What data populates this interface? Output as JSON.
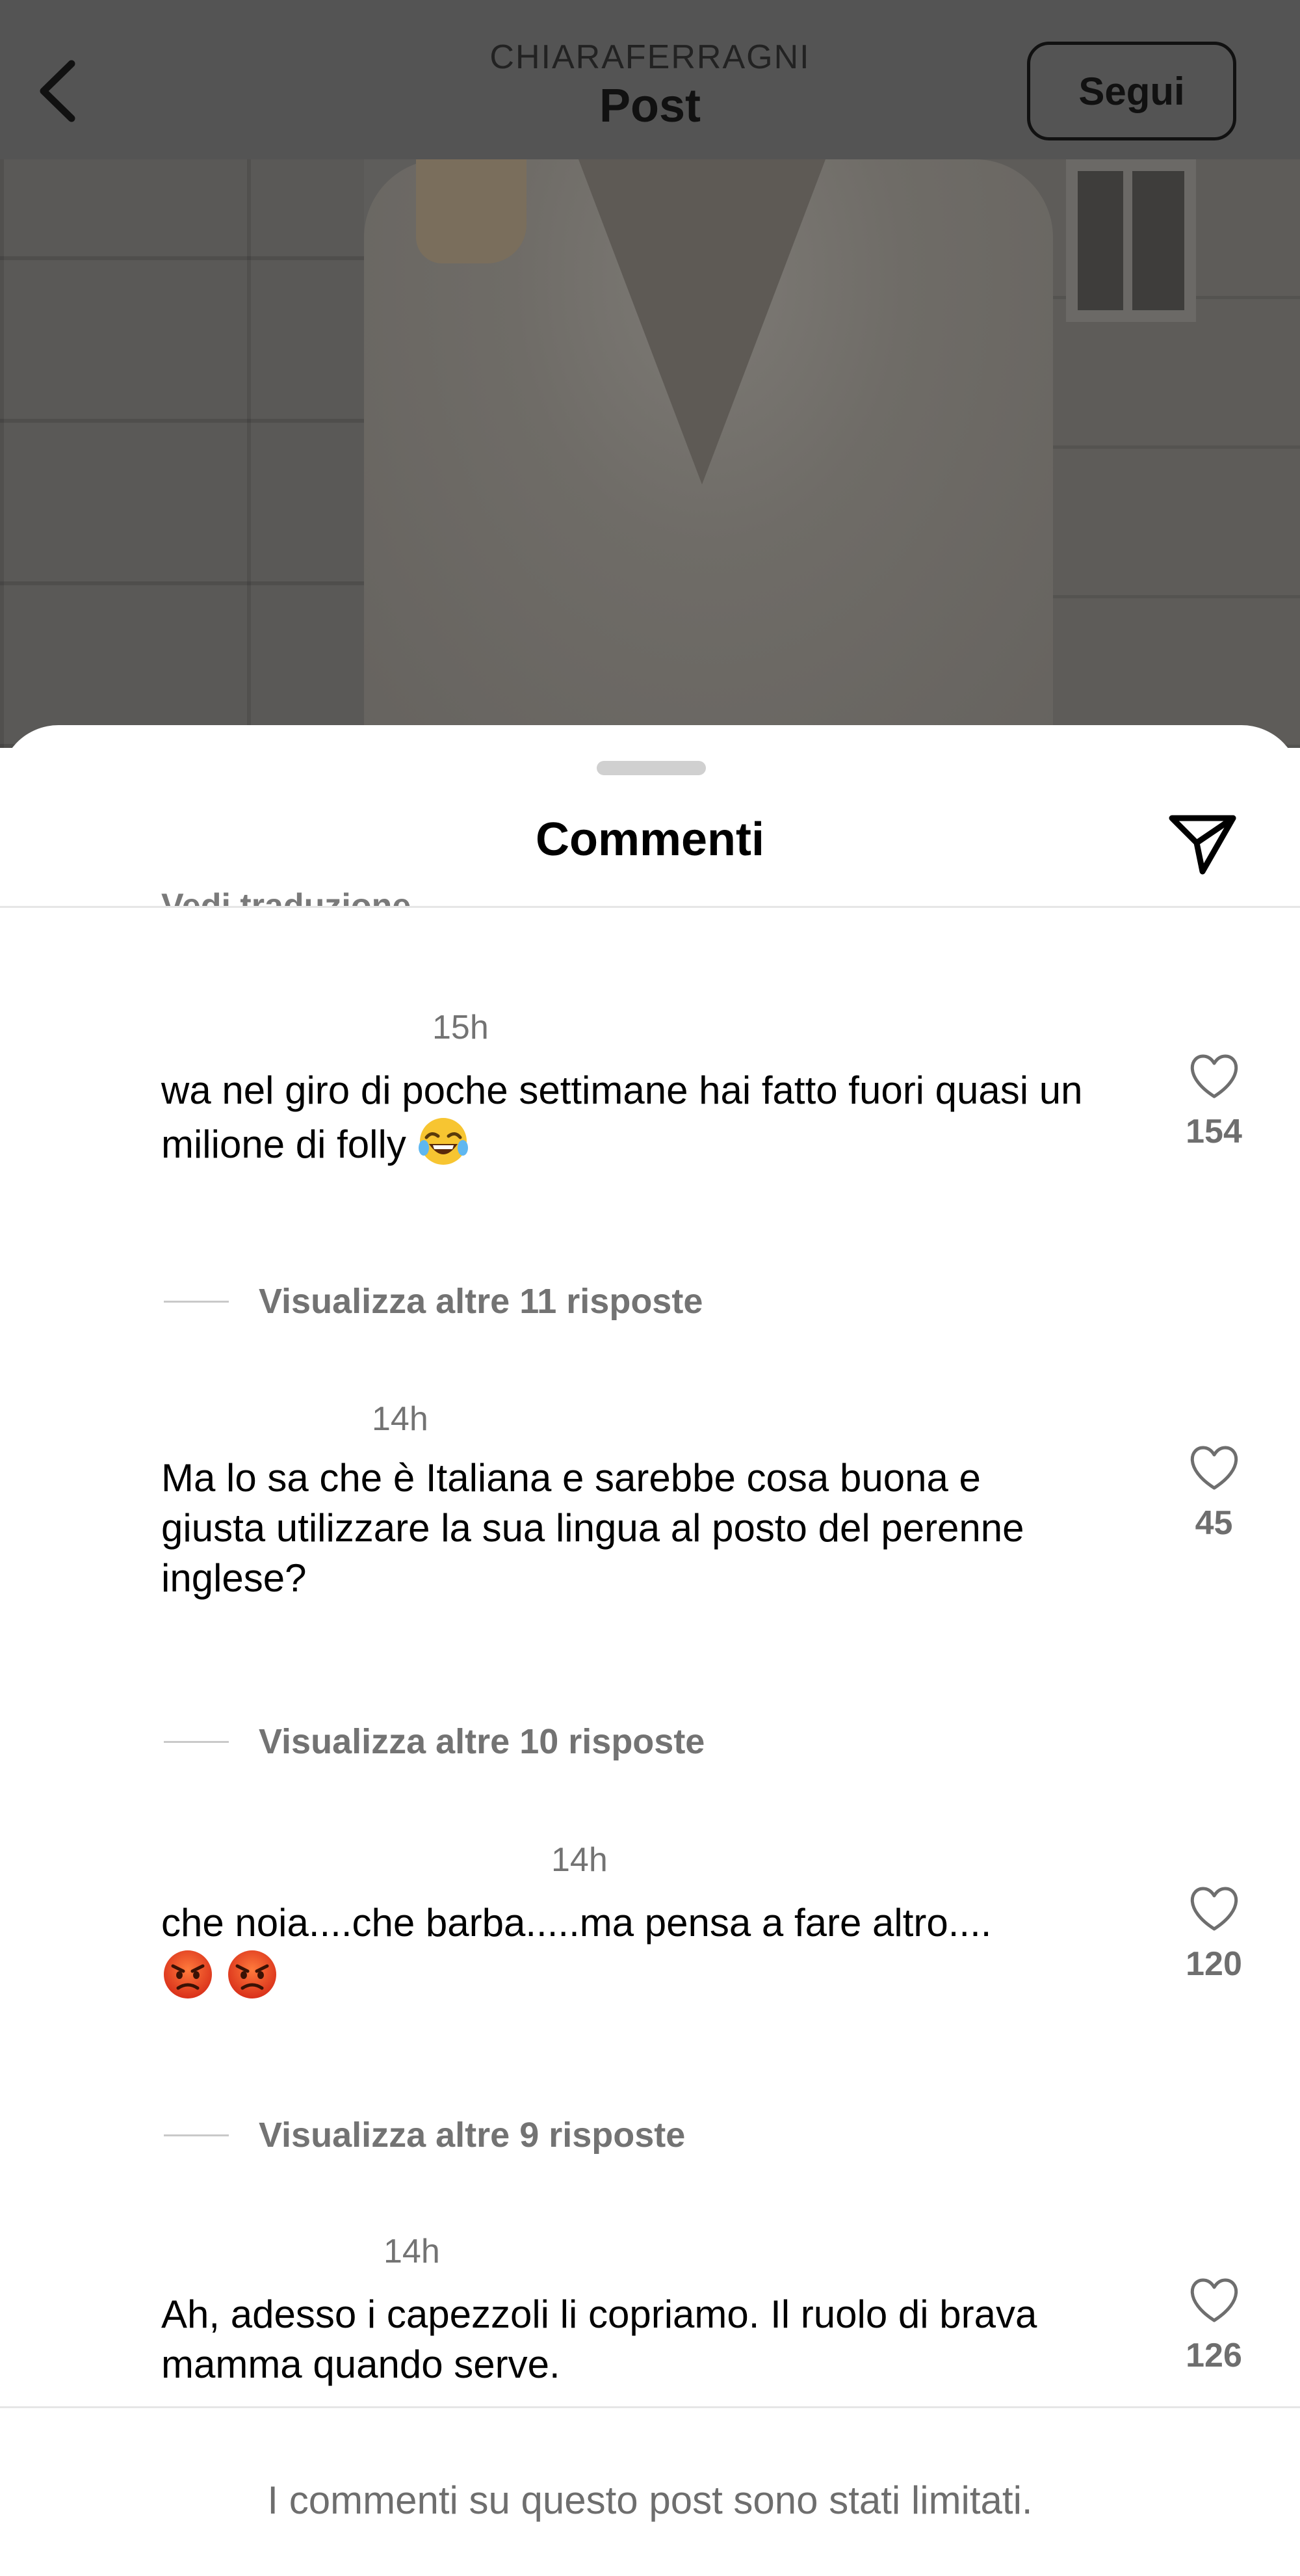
{
  "header": {
    "account_name": "CHIARAFERRAGNI",
    "title": "Post",
    "follow_label": "Segui",
    "back_icon": "chevron-left-icon"
  },
  "sheet": {
    "title": "Commenti",
    "clipped_text": "Vedi traduzione",
    "share_icon": "paper-plane-icon"
  },
  "comments": [
    {
      "time": "15h",
      "text": "wa nel giro di poche settimane hai fatto fuori quasi un milione di folly",
      "emoji": "face-with-tears-of-joy",
      "likes": "154",
      "replies_label": "Visualizza altre 11 risposte"
    },
    {
      "time": "14h",
      "text": "Ma lo sa che è Italiana e sarebbe cosa buona e giusta utilizzare la sua lingua al posto del perenne inglese?",
      "likes": "45",
      "replies_label": "Visualizza altre 10 risposte"
    },
    {
      "time": "14h",
      "text": "che noia....che barba.....ma pensa a fare altro....",
      "emoji": "angry-face x2",
      "likes": "120",
      "replies_label": "Visualizza altre 9 risposte"
    },
    {
      "time": "14h",
      "text": "Ah, adesso i capezzoli li copriamo. Il ruolo di brava mamma quando serve.",
      "likes": "126"
    }
  ],
  "footer": {
    "notice": "I commenti su questo post sono stati limitati."
  },
  "colors": {
    "topbar": "#545454",
    "muted_text": "#737373",
    "divider": "#e6e6e6"
  }
}
